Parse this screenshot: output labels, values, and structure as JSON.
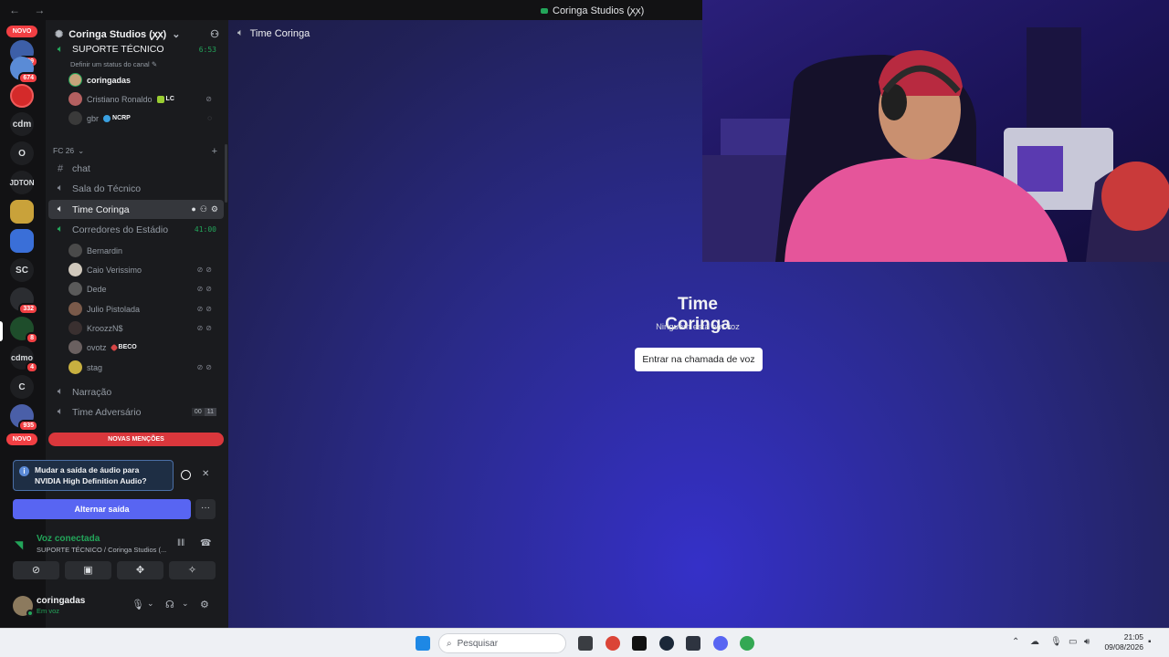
{
  "window": {
    "title": "Coringa Studios (ꭗꭗ)",
    "nav": "← →"
  },
  "server_rail": {
    "novo_top": "NOVO",
    "novo_bottom": "NOVO",
    "badges": [
      "829",
      "674",
      "332",
      "8",
      "4",
      "935"
    ],
    "text_servers": [
      "cdm",
      "O",
      "JDTON",
      "SC",
      "cdmo",
      "C"
    ]
  },
  "sidebar": {
    "server_name": "Coringa Studios (ꭗꭗ)",
    "top_channel": {
      "name": "SUPORTE TÉCNICO",
      "timer": "6:53",
      "status_hint": "Definir um status do canal"
    },
    "top_users": [
      {
        "name": "coringadas",
        "tag": ""
      },
      {
        "name": "Cristiano Ronaldo",
        "tag": "LC"
      },
      {
        "name": "gbr",
        "tag": "NCRP"
      }
    ],
    "category": "FC 26",
    "channels": {
      "chat": "chat",
      "sala": "Sala do Técnico",
      "time": "Time Coringa",
      "corredores": "Corredores do Estádio",
      "corredores_timer": "41:00",
      "narracao": "Narração",
      "adversario": "Time Adversário",
      "adversario_count": [
        "00",
        "11"
      ]
    },
    "corredores_users": [
      {
        "name": "Bernardin",
        "tag": ""
      },
      {
        "name": "Caio Verissimo",
        "tag": ""
      },
      {
        "name": "Dede",
        "tag": ""
      },
      {
        "name": "Julio Pistolada",
        "tag": ""
      },
      {
        "name": "KroozzN$",
        "tag": ""
      },
      {
        "name": "ovotz",
        "tag": "BECO"
      },
      {
        "name": "stag",
        "tag": ""
      }
    ],
    "new_mentions": "NOVAS MENÇÕES"
  },
  "audio_notice": {
    "text": "Mudar a saída de áudio para NVIDIA High Definition Audio?",
    "switch_button": "Alternar saída",
    "more": "···"
  },
  "voice_status": {
    "title": "Voz conectada",
    "channel": "SUPORTE TÉCNICO / Coringa Studios (..."
  },
  "user_panel": {
    "name": "coringadas",
    "status": "Em voz"
  },
  "main": {
    "header": "Time Coringa",
    "voice_title": "Time Coringa",
    "voice_subtitle": "Ninguém está em voz",
    "join_button": "Entrar na chamada de voz"
  },
  "taskbar": {
    "search_placeholder": "Pesquisar",
    "time": "21:05",
    "date": "09/08/2026"
  },
  "colors": {
    "accent": "#5865f2",
    "online": "#23a55a",
    "danger": "#da373c"
  }
}
